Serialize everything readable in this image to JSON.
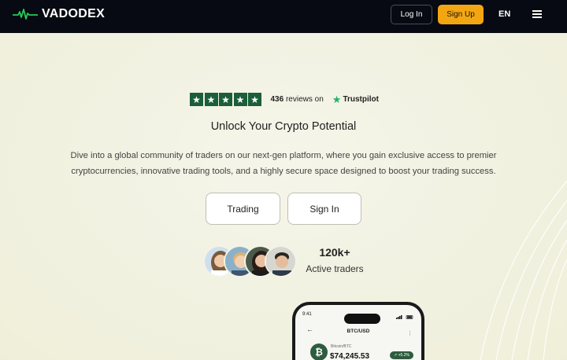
{
  "header": {
    "brand": "VADODEX",
    "login_label": "Log In",
    "signup_label": "Sign Up",
    "language": "EN",
    "logo_icon": "heartbeat-icon",
    "menu_icon": "hamburger-icon"
  },
  "trustpilot": {
    "stars": 5,
    "reviews_count": "436",
    "reviews_text": "reviews on",
    "brand": "Trustpilot"
  },
  "hero": {
    "title": "Unlock Your Crypto Potential",
    "description": "Dive into a global community of traders on our next-gen platform, where you gain exclusive access to premier cryptocurrencies, innovative trading tools, and a highly secure space designed to boost your trading success.",
    "trading_label": "Trading",
    "signin_label": "Sign In"
  },
  "traders": {
    "count": "120k+",
    "label": "Active traders"
  },
  "phone": {
    "time": "9:41",
    "pair": "BTC/USD",
    "coin_symbol": "₿",
    "coin_name": "Bitcoin/BTC",
    "price": "$74,245.53",
    "change": "↗ +5.2%"
  },
  "colors": {
    "header_bg": "#070a12",
    "accent": "#f4a612",
    "brand_green": "#27c85a",
    "trustpilot_star_bg": "#1b5e3a",
    "page_bg": "#f3f3e6"
  }
}
